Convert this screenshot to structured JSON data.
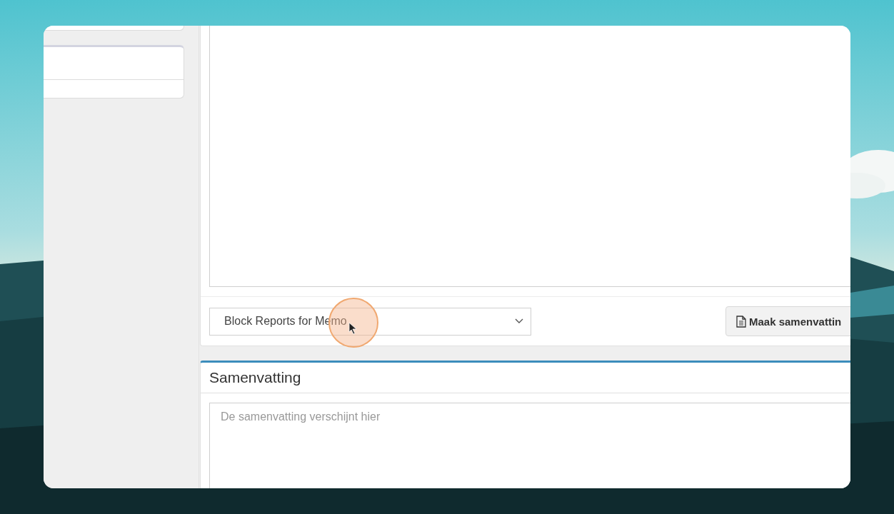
{
  "report_select": {
    "value": "Block Reports for Memo"
  },
  "summarize_button": {
    "label": "Maak samenvattin"
  },
  "summary": {
    "title": "Samenvatting",
    "placeholder": "De samenvatting verschijnt hier"
  }
}
